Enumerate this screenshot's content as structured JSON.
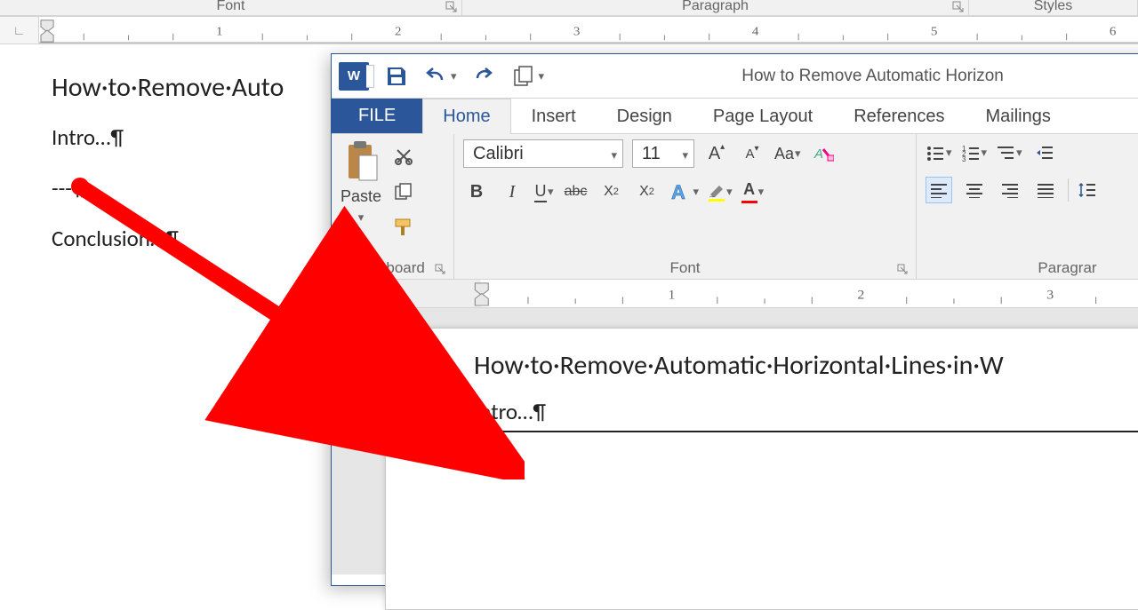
{
  "bg": {
    "group_font": "Font",
    "group_paragraph": "Paragraph",
    "group_styles": "Styles",
    "ruler_numbers": [
      "1",
      "2",
      "3",
      "4",
      "5",
      "6"
    ],
    "doc": {
      "title": "How·to·Remove·Auto",
      "intro": "Intro…¶",
      "dashes": "---¶",
      "conclusion": "Conclusion…¶"
    }
  },
  "fg": {
    "window_title": "How to Remove Automatic Horizon",
    "tabs": {
      "file": "FILE",
      "home": "Home",
      "insert": "Insert",
      "design": "Design",
      "page_layout": "Page Layout",
      "references": "References",
      "mailings": "Mailings"
    },
    "clipboard": {
      "paste": "Paste",
      "label": "Clipboard"
    },
    "font": {
      "name": "Calibri",
      "size": "11",
      "grow": "A",
      "shrink": "A",
      "case": "Aa",
      "bold": "B",
      "italic": "I",
      "underline": "U",
      "strike": "abc",
      "subscript": "X₂",
      "superscript": "X²",
      "label": "Font"
    },
    "paragraph": {
      "label": "Paragrar"
    },
    "ruler_numbers": [
      "1",
      "2",
      "3"
    ],
    "doc": {
      "title": "How·to·Remove·Automatic·Horizontal·Lines·in·W",
      "intro": "Intro…¶",
      "blank": "¶"
    }
  }
}
